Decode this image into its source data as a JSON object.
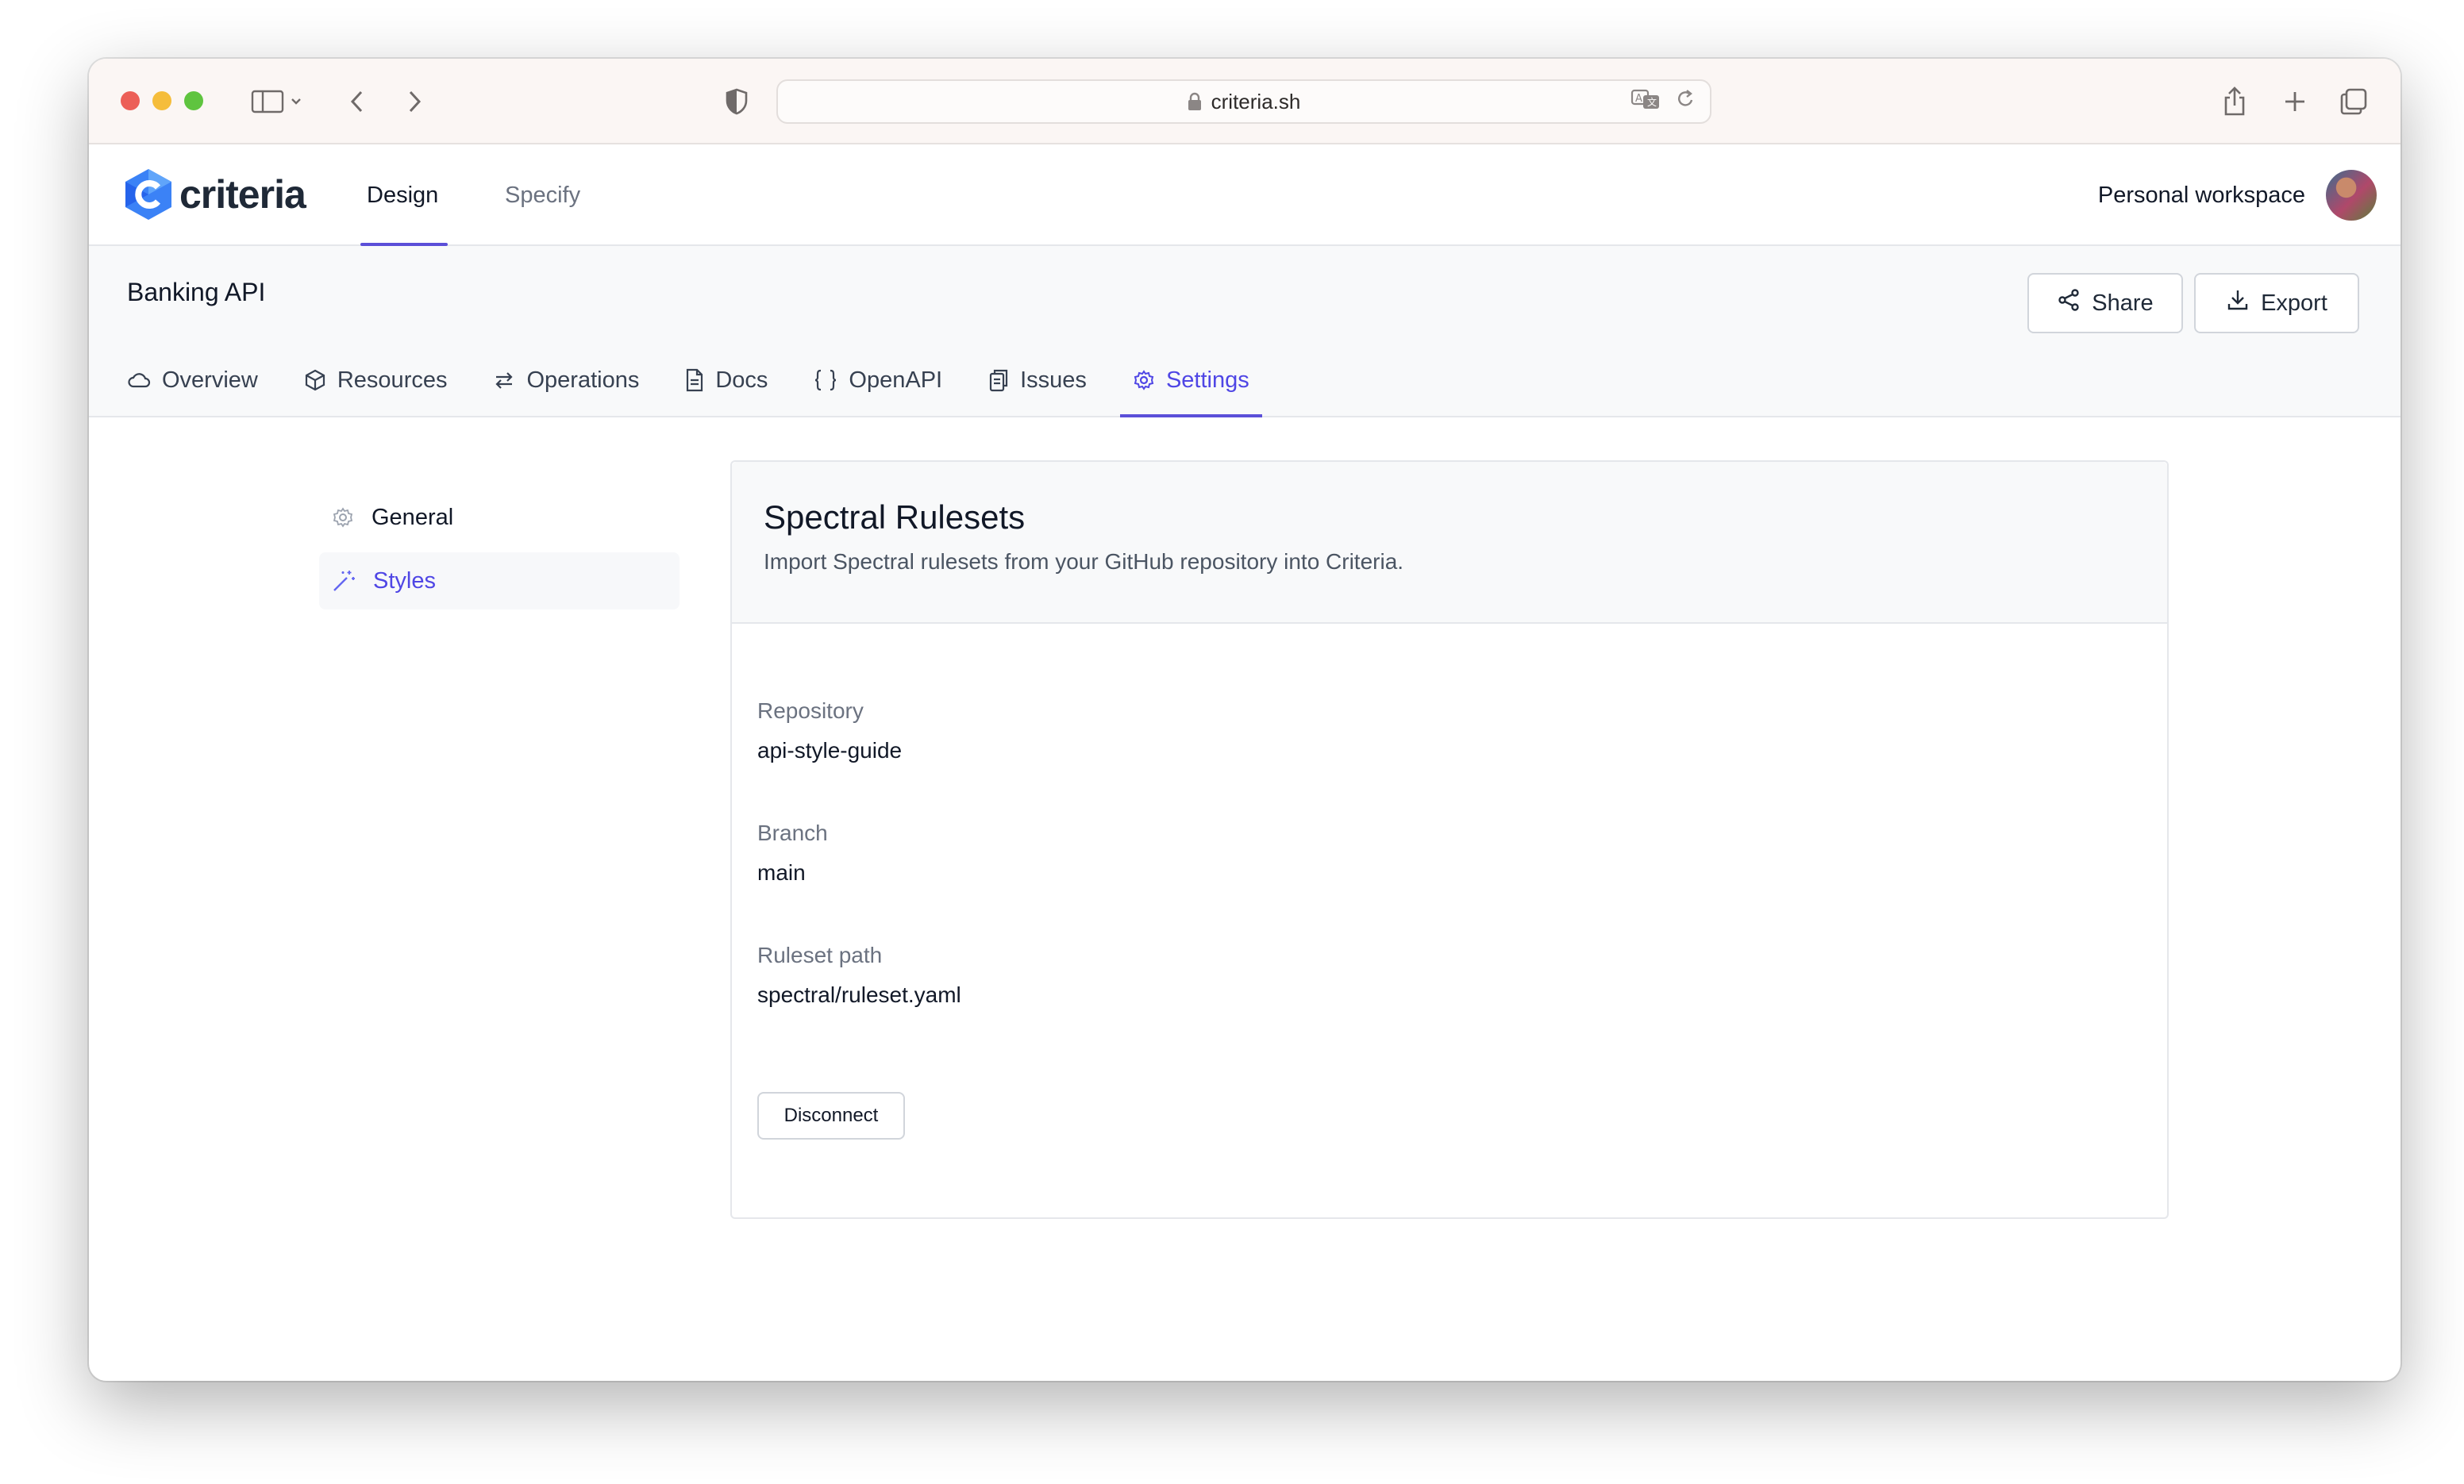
{
  "browser": {
    "url": "criteria.sh"
  },
  "app": {
    "brand": "criteria",
    "top_nav": [
      {
        "label": "Design",
        "active": true
      },
      {
        "label": "Specify",
        "active": false
      }
    ],
    "workspace_label": "Personal workspace"
  },
  "project": {
    "title": "Banking API",
    "share_label": "Share",
    "export_label": "Export",
    "tabs": [
      {
        "label": "Overview",
        "icon": "cloud-icon"
      },
      {
        "label": "Resources",
        "icon": "cube-icon"
      },
      {
        "label": "Operations",
        "icon": "arrows-icon"
      },
      {
        "label": "Docs",
        "icon": "document-icon"
      },
      {
        "label": "OpenAPI",
        "icon": "braces-icon"
      },
      {
        "label": "Issues",
        "icon": "clipboard-icon"
      },
      {
        "label": "Settings",
        "icon": "gear-icon",
        "active": true
      }
    ]
  },
  "settings_menu": [
    {
      "label": "General",
      "icon": "gear-icon",
      "active": false
    },
    {
      "label": "Styles",
      "icon": "magic-wand-icon",
      "active": true
    }
  ],
  "card": {
    "title": "Spectral Rulesets",
    "subtitle": "Import Spectral rulesets from your GitHub repository into Criteria.",
    "fields": [
      {
        "label": "Repository",
        "value": "api-style-guide"
      },
      {
        "label": "Branch",
        "value": "main"
      },
      {
        "label": "Ruleset path",
        "value": "spectral/ruleset.yaml"
      }
    ],
    "disconnect_label": "Disconnect"
  },
  "colors": {
    "accent": "#4f46e5",
    "accent_underline": "#5b4fd8",
    "logo_blue": "#3b82f6"
  }
}
